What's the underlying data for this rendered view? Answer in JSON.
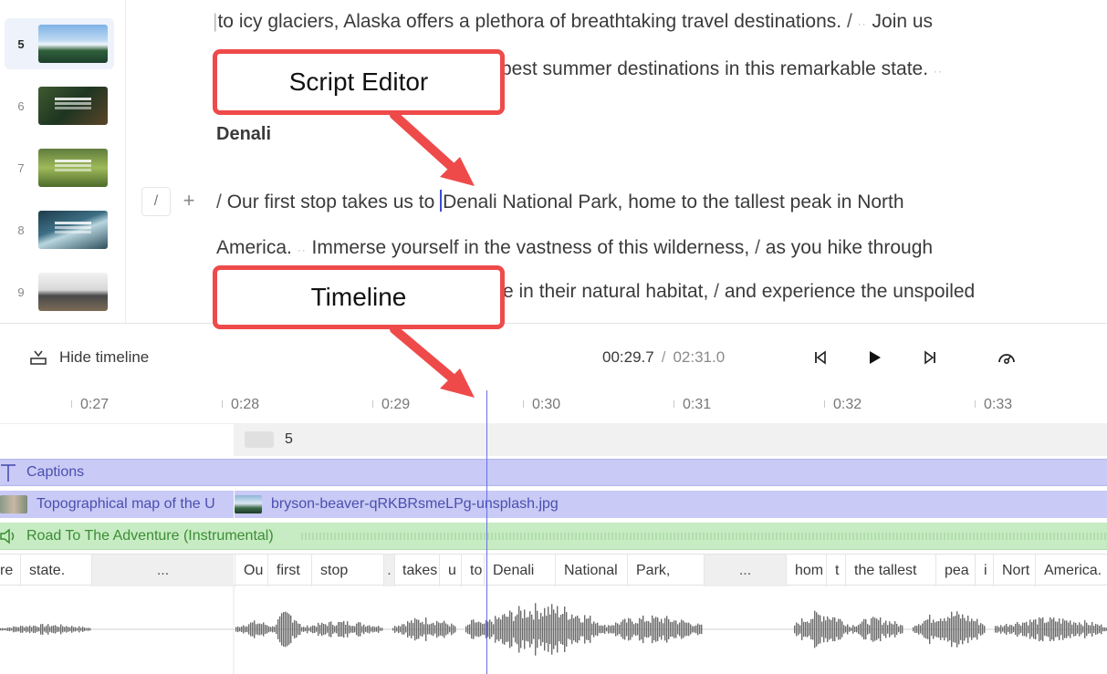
{
  "slides": [
    {
      "number": "5",
      "active": true
    },
    {
      "number": "6",
      "active": false
    },
    {
      "number": "7",
      "active": false
    },
    {
      "number": "8",
      "active": false
    },
    {
      "number": "9",
      "active": false
    }
  ],
  "script": {
    "line1_text": "to icy glaciers, Alaska offers a plethora of breathtaking travel destinations.",
    "line1_tail": "Join us",
    "line2_text": "best summer destinations in this remarkable state.",
    "heading": "Denali",
    "line3_before_cursor": "Our first stop takes us to",
    "line3_after_cursor": "Denali National Park, home to the tallest peak in North",
    "line4_a": "America.",
    "line4_b": "Immerse yourself in the vastness of this wilderness,",
    "line4_c": "as you hike through",
    "line5_a": "e in their natural habitat,",
    "line5_b": "and experience the unspoiled",
    "slash_marker": "/",
    "pause_marker": "··"
  },
  "line_tools": {
    "slash": "/",
    "plus": "+"
  },
  "annotations": {
    "script_editor": "Script Editor",
    "timeline": "Timeline",
    "color": "#ef4a4a"
  },
  "transport": {
    "hide_timeline_label": "Hide timeline",
    "current_time": "00:29.7",
    "separator": "/",
    "total_time": "02:31.0"
  },
  "ruler": [
    "0:27",
    "0:28",
    "0:29",
    "0:30",
    "0:31",
    "0:32",
    "0:33"
  ],
  "scene": {
    "number": "5"
  },
  "tracks": {
    "captions": "Captions",
    "media_1": "Topographical map of the U",
    "media_2": "bryson-beaver-qRKBRsmeLPg-unsplash.jpg",
    "music": "Road To The Adventure (Instrumental)"
  },
  "words": [
    "re",
    "state.",
    "...",
    "Ou",
    "first",
    "stop",
    ".",
    "takes",
    "u",
    "to",
    "Denali",
    "National",
    "Park,",
    "...",
    "hom",
    "t",
    "the tallest",
    "pea",
    "i",
    "Nort",
    "America."
  ],
  "colors": {
    "accent": "#3c4bd1",
    "captions_track": "#c9caf5",
    "music_track": "#c7ebc3",
    "playhead": "#6670e8"
  }
}
